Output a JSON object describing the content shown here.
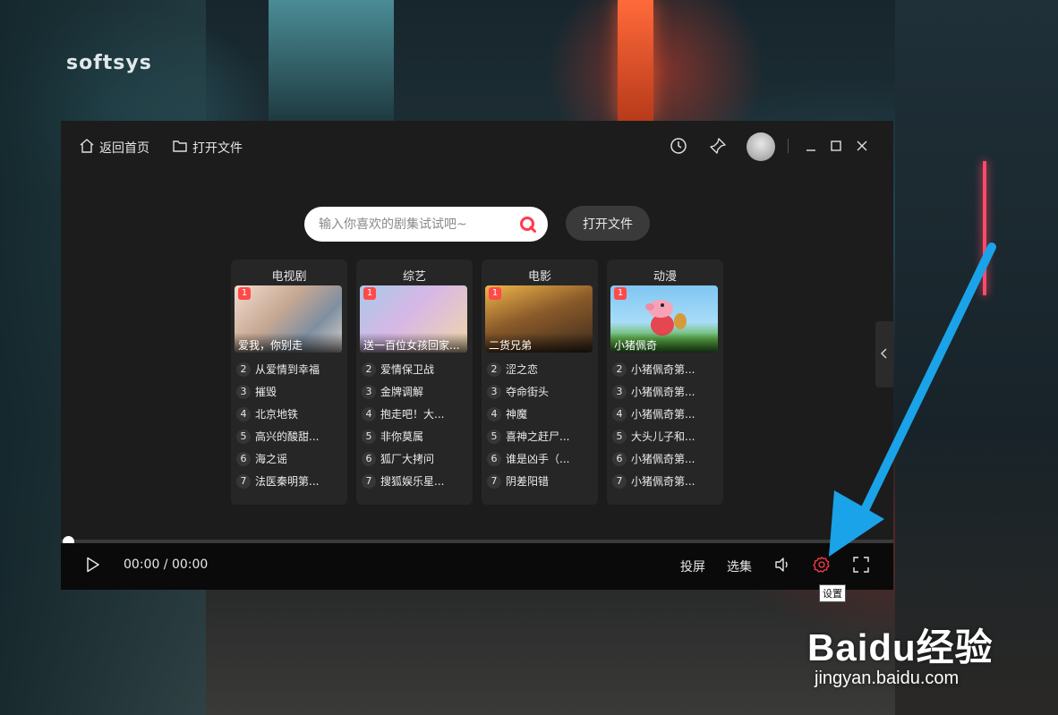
{
  "background": {
    "sign": "softsys",
    "watermark_main": "Baidu经验",
    "watermark_sub": "jingyan.baidu.com"
  },
  "titlebar": {
    "home_label": "返回首页",
    "open_label": "打开文件",
    "history_icon": "clock-icon",
    "pin_icon": "pin-icon",
    "minimize_icon": "minimize-icon",
    "maximize_icon": "maximize-icon",
    "close_icon": "close-icon"
  },
  "search": {
    "placeholder": "输入你喜欢的剧集试试吧~",
    "button_label": "打开文件"
  },
  "categories": [
    {
      "title": "电视剧",
      "badge": "1",
      "poster_caption": "爱我，你别走",
      "items": [
        {
          "n": "2",
          "t": "从爱情到幸福"
        },
        {
          "n": "3",
          "t": "摧毁"
        },
        {
          "n": "4",
          "t": "北京地铁"
        },
        {
          "n": "5",
          "t": "高兴的酸甜..."
        },
        {
          "n": "6",
          "t": "海之谣"
        },
        {
          "n": "7",
          "t": "法医秦明第..."
        }
      ]
    },
    {
      "title": "综艺",
      "badge": "1",
      "poster_caption": "送一百位女孩回家...",
      "items": [
        {
          "n": "2",
          "t": "爱情保卫战"
        },
        {
          "n": "3",
          "t": "金牌调解"
        },
        {
          "n": "4",
          "t": "抱走吧！大..."
        },
        {
          "n": "5",
          "t": "非你莫属"
        },
        {
          "n": "6",
          "t": "狐厂大拷问"
        },
        {
          "n": "7",
          "t": "搜狐娱乐星..."
        }
      ]
    },
    {
      "title": "电影",
      "badge": "1",
      "poster_caption": "二货兄弟",
      "items": [
        {
          "n": "2",
          "t": "涩之恋"
        },
        {
          "n": "3",
          "t": "夺命街头"
        },
        {
          "n": "4",
          "t": "神魔"
        },
        {
          "n": "5",
          "t": "喜神之赶尸..."
        },
        {
          "n": "6",
          "t": "谁是凶手（..."
        },
        {
          "n": "7",
          "t": "阴差阳错"
        }
      ]
    },
    {
      "title": "动漫",
      "badge": "1",
      "poster_caption": "小猪佩奇",
      "items": [
        {
          "n": "2",
          "t": "小猪佩奇第..."
        },
        {
          "n": "3",
          "t": "小猪佩奇第..."
        },
        {
          "n": "4",
          "t": "小猪佩奇第..."
        },
        {
          "n": "5",
          "t": "大头儿子和..."
        },
        {
          "n": "6",
          "t": "小猪佩奇第..."
        },
        {
          "n": "7",
          "t": "小猪佩奇第..."
        }
      ]
    }
  ],
  "player": {
    "time": "00:00  /  00:00",
    "progress": 0,
    "cast_label": "投屏",
    "episodes_label": "选集",
    "settings_tooltip": "设置"
  },
  "colors": {
    "accent_red": "#ff3b4a",
    "annotation_arrow": "#1aa3e8"
  }
}
